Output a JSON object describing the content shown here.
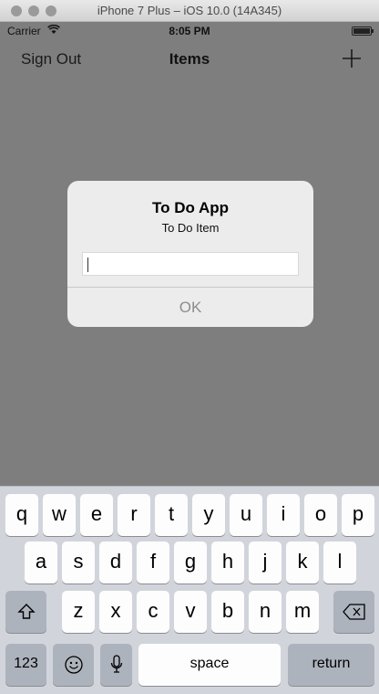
{
  "simulator": {
    "title": "iPhone 7 Plus – iOS 10.0 (14A345)"
  },
  "status_bar": {
    "carrier": "Carrier",
    "wifi_icon": "wifi-icon",
    "time": "8:05 PM",
    "battery_icon": "battery-icon"
  },
  "nav_bar": {
    "left_button": "Sign Out",
    "title": "Items",
    "right_icon": "plus-icon"
  },
  "alert": {
    "title": "To Do App",
    "message": "To Do Item",
    "input_value": "",
    "ok_label": "OK"
  },
  "keyboard": {
    "row1": [
      "q",
      "w",
      "e",
      "r",
      "t",
      "y",
      "u",
      "i",
      "o",
      "p"
    ],
    "row2": [
      "a",
      "s",
      "d",
      "f",
      "g",
      "h",
      "j",
      "k",
      "l"
    ],
    "row3": [
      "z",
      "x",
      "c",
      "v",
      "b",
      "n",
      "m"
    ],
    "shift_icon": "shift-icon",
    "delete_icon": "delete-icon",
    "numbers_label": "123",
    "emoji_icon": "emoji-icon",
    "mic_icon": "microphone-icon",
    "space_label": "space",
    "return_label": "return"
  },
  "colors": {
    "dimmed_background": "#7e7e7e",
    "keyboard_background": "#d1d5db",
    "alert_background": "#ececec"
  }
}
